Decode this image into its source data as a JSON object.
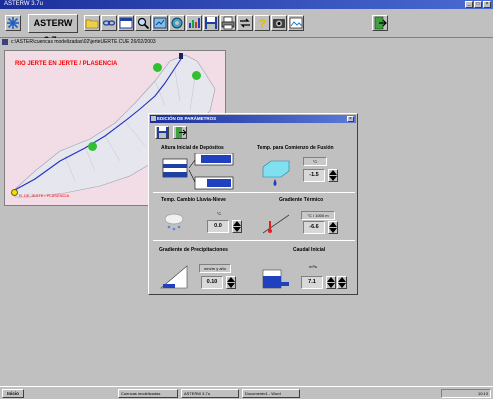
{
  "window": {
    "title": "ASTERW 3.7u"
  },
  "toolbar": {
    "app_name": "ASTERW 3.7u"
  },
  "pathbar": {
    "path": "c:\\ASTER\\cuencas modelizadas\\02\\jerteUERTE.CUE   26/02/2003"
  },
  "map": {
    "title": "RIO JERTE EN JERTE / PLASENCIA",
    "outlet_label": "R. DE JERTE / PLASENCIA"
  },
  "dialog": {
    "title": "EDICIÓN DE PARÁMETROS",
    "sections": [
      {
        "title": "Altura Inicial de Depósitos"
      },
      {
        "title": "Temp. para Comienzo de Fusión",
        "unit": "°C",
        "value": "-1.5"
      },
      {
        "title": "Temp. Cambio Lluvia-Nieve",
        "unit": "°C",
        "value": "0.0"
      },
      {
        "title": "Gradiente Térmico",
        "unit": "°C / 1000 m",
        "value": "-6.6"
      },
      {
        "title": "Gradiente de Precipitaciones",
        "unit": "mm/m y año",
        "value": "0.10"
      },
      {
        "title": "Caudal Inicial",
        "unit": "m³/s",
        "value": "7.1"
      }
    ]
  },
  "taskbar": {
    "start": "Inicio",
    "tasks": [
      "Cuencas modelizadas",
      "ASTERW 3.7u",
      "Documento1 - Word"
    ],
    "clock": "10:13"
  },
  "colors": {
    "title_bar": "#1a2e9a",
    "map_bg": "#f2dce6",
    "map_label": "#ff0000",
    "river": "#2030c0"
  }
}
